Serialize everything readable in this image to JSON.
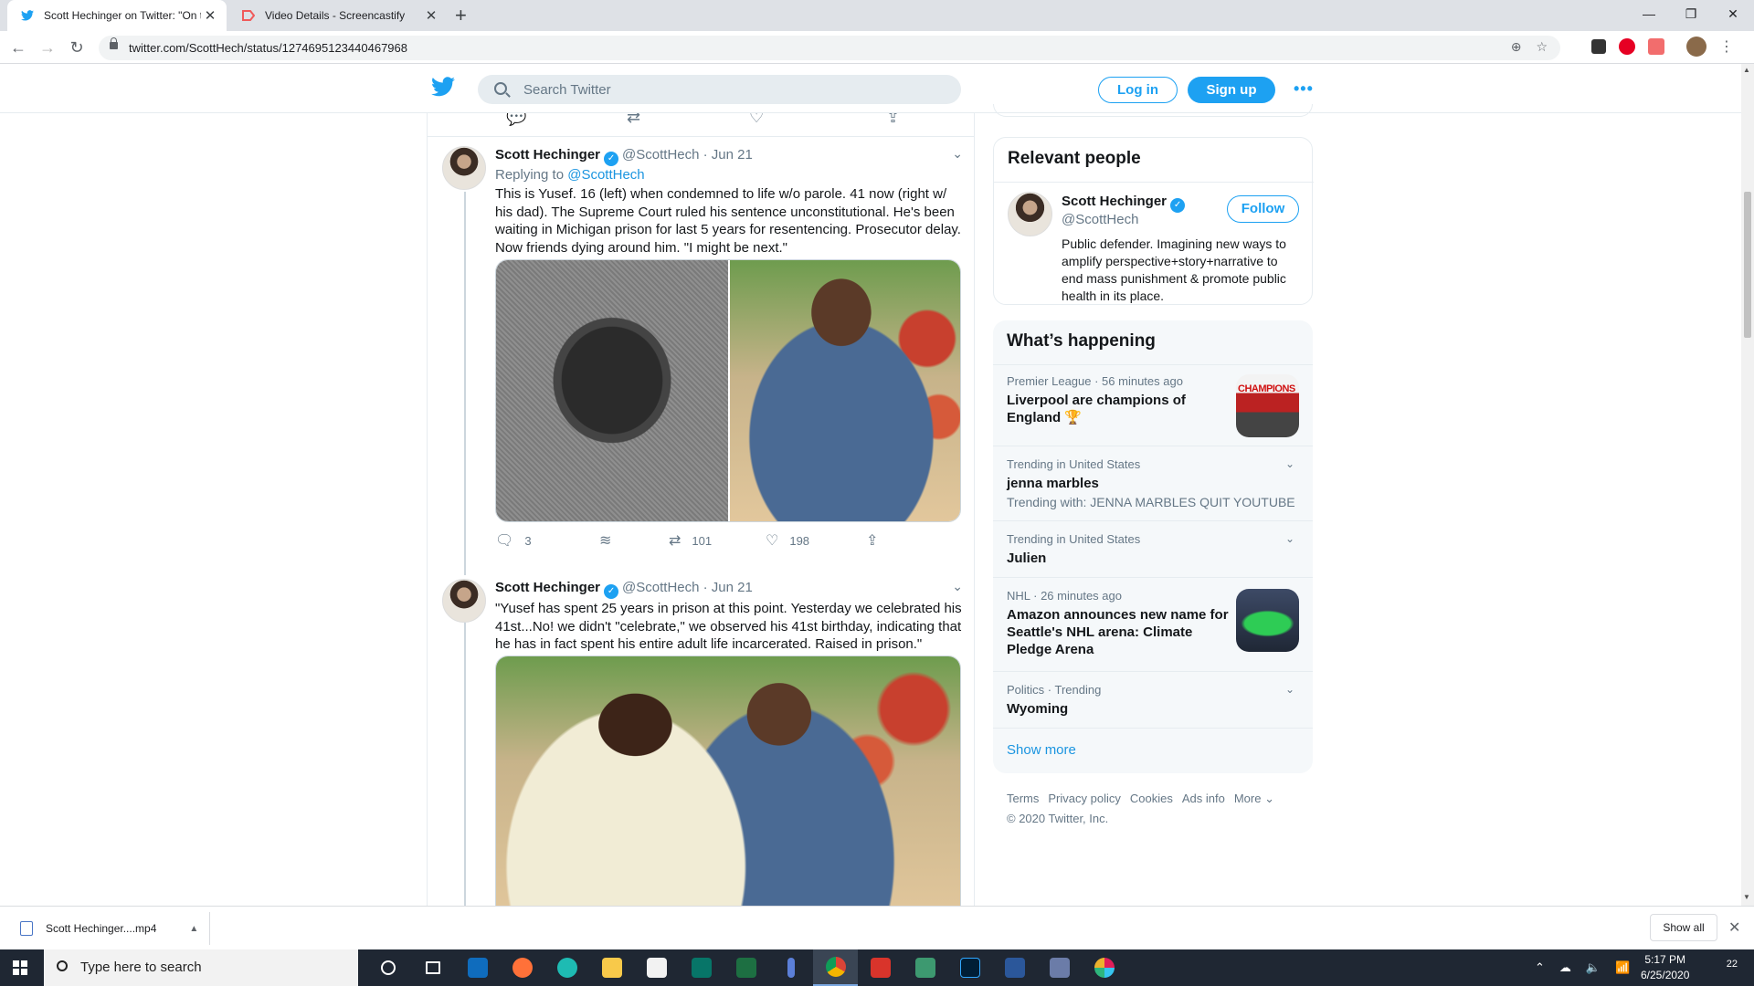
{
  "browser": {
    "tabs": [
      {
        "title": "Scott Hechinger on Twitter: \"On t",
        "active": true,
        "icon": "twitter-icon"
      },
      {
        "title": "Video Details - Screencastify",
        "active": false,
        "icon": "screencastify-icon"
      }
    ],
    "url": "twitter.com/ScottHech/status/1274695123440467968"
  },
  "twitter": {
    "search_placeholder": "Search Twitter",
    "login_label": "Log in",
    "signup_label": "Sign up",
    "tweets": [
      {
        "name": "Scott Hechinger",
        "handle": "@ScottHech",
        "date": "· Jun 21",
        "replying_prefix": "Replying to ",
        "replying_to": "@ScottHech",
        "text": "This is Yusef. 16 (left) when condemned to life w/o parole. 41 now (right w/ his dad). The Supreme Court ruled his sentence unconstitutional. He's been waiting in Michigan prison for last 5 years for resentencing. Prosecutor delay. Now friends dying around him. \"I might be next.\"",
        "replies": "3",
        "retweets": "101",
        "likes": "198"
      },
      {
        "name": "Scott Hechinger",
        "handle": "@ScottHech",
        "date": "· Jun 21",
        "text": "\"Yusef has spent 25 years in prison at this point. Yesterday we celebrated his 41st...No! we didn't \"celebrate,\" we observed his 41st birthday, indicating that he has in fact spent his entire adult life incarcerated. Raised in prison.\""
      }
    ],
    "relevant_people": {
      "title": "Relevant people",
      "name": "Scott Hechinger",
      "handle": "@ScottHech",
      "follow_label": "Follow",
      "bio": "Public defender. Imagining new ways to amplify perspective+story+narrative to end mass punishment & promote public health in its place."
    },
    "happening": {
      "title": "What’s happening",
      "trends": [
        {
          "context": "Premier League · 56 minutes ago",
          "title": "Liverpool are champions of England 🏆",
          "thumb_text": "CHAMPIONS"
        },
        {
          "context": "Trending in United States",
          "title": "jenna marbles",
          "with": "Trending with: JENNA MARBLES QUIT YOUTUBE"
        },
        {
          "context": "Trending in United States",
          "title": "Julien"
        },
        {
          "context": "NHL · 26 minutes ago",
          "title": "Amazon announces new name for Seattle's NHL arena: Climate Pledge Arena"
        },
        {
          "context": "Politics · Trending",
          "title": "Wyoming"
        }
      ],
      "show_more": "Show more"
    },
    "footer": {
      "links": [
        "Terms",
        "Privacy policy",
        "Cookies",
        "Ads info",
        "More"
      ],
      "copyright": "© 2020 Twitter, Inc."
    }
  },
  "downloads": {
    "file": "Scott Hechinger....mp4",
    "show_all": "Show all"
  },
  "taskbar": {
    "search_text": "Type here to search",
    "time": "5:17 PM",
    "date": "6/25/2020",
    "notifications": "22"
  },
  "colors": {
    "twitter_blue": "#1da1f2",
    "link_blue": "#1b95e0",
    "taskbar": "#1f2733"
  }
}
